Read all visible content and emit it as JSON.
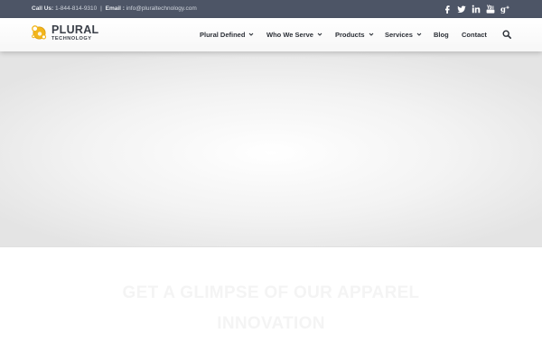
{
  "topbar": {
    "call_label": "Call Us:",
    "phone": "1-844-814-9310",
    "separator": "|",
    "email_label": "Email :",
    "email": "info@pluraltechnology.com",
    "social_icons": [
      "facebook-icon",
      "twitter-icon",
      "linkedin-icon",
      "youtube-icon",
      "google-plus-icon"
    ]
  },
  "logo": {
    "name": "PLURAL",
    "sub": "TECHNOLOGY"
  },
  "nav": {
    "items": [
      {
        "label": "Plural Defined",
        "has_dropdown": true
      },
      {
        "label": "Who We Serve",
        "has_dropdown": true
      },
      {
        "label": "Products",
        "has_dropdown": true
      },
      {
        "label": "Services",
        "has_dropdown": true
      },
      {
        "label": "Blog",
        "has_dropdown": false
      },
      {
        "label": "Contact",
        "has_dropdown": false
      }
    ],
    "search_icon": "search-icon"
  },
  "hero": {
    "headline_line1": "GET A GLIMPSE OF OUR APPAREL",
    "headline_line2": "INNOVATION"
  },
  "colors": {
    "topbar_bg": "#4d5566",
    "accent_yellow": "#f2b51b",
    "nav_text": "#2b2f36"
  }
}
